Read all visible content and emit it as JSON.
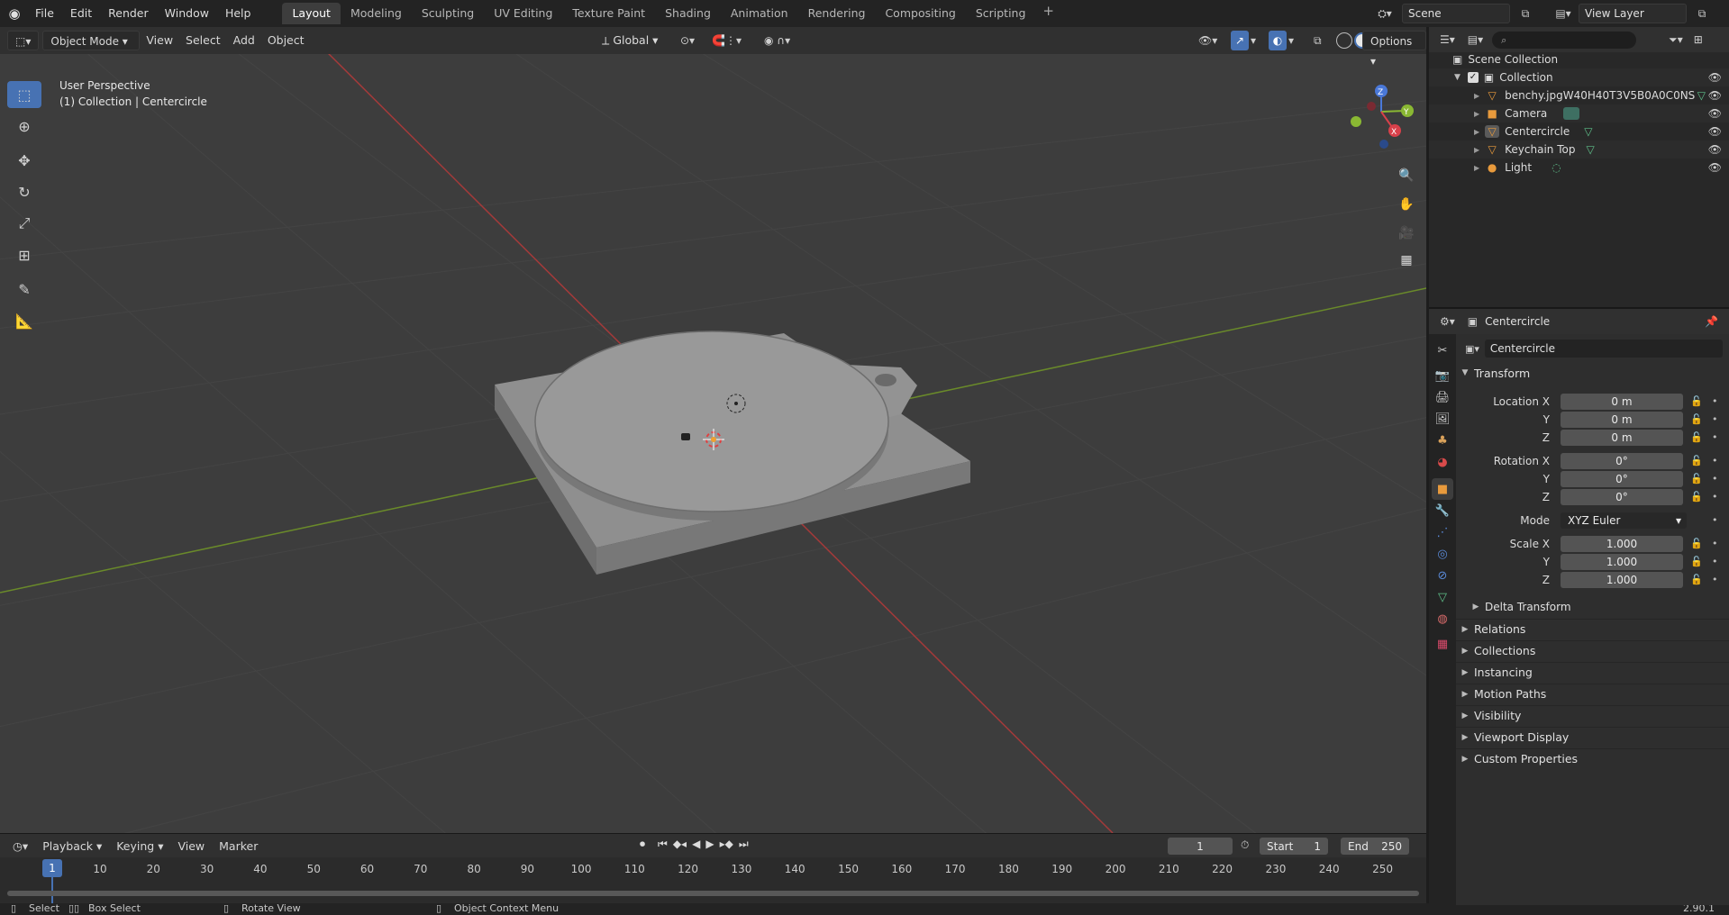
{
  "top_menu": [
    "File",
    "Edit",
    "Render",
    "Window",
    "Help"
  ],
  "workspaces": [
    "Layout",
    "Modeling",
    "Sculpting",
    "UV Editing",
    "Texture Paint",
    "Shading",
    "Animation",
    "Rendering",
    "Compositing",
    "Scripting"
  ],
  "active_workspace": "Layout",
  "scene": "Scene",
  "view_layer": "View Layer",
  "viewport": {
    "mode": "Object Mode",
    "menus": [
      "View",
      "Select",
      "Add",
      "Object"
    ],
    "transform_orientation": "Global",
    "options_label": "Options",
    "view_name": "User Perspective",
    "collection_info": "(1) Collection | Centercircle",
    "gizmo": {
      "x": "X",
      "y": "Y",
      "z": "Z"
    }
  },
  "outliner": {
    "root": "Scene Collection",
    "collection": "Collection",
    "items": [
      "benchy.jpgW40H40T3V5B0A0C0NS",
      "Camera",
      "Centercircle",
      "Keychain Top",
      "Light"
    ]
  },
  "properties": {
    "object_name": "Centercircle",
    "data_name": "Centercircle",
    "transform_label": "Transform",
    "location": {
      "label_x": "Location X",
      "x": "0 m",
      "y": "0 m",
      "z": "0 m"
    },
    "rotation": {
      "label_x": "Rotation X",
      "x": "0°",
      "y": "0°",
      "z": "0°"
    },
    "mode_label": "Mode",
    "mode_value": "XYZ Euler",
    "scale": {
      "label_x": "Scale X",
      "x": "1.000",
      "y": "1.000",
      "z": "1.000"
    },
    "axis_y": "Y",
    "axis_z": "Z",
    "delta_transform": "Delta Transform",
    "sections": [
      "Relations",
      "Collections",
      "Instancing",
      "Motion Paths",
      "Visibility",
      "Viewport Display",
      "Custom Properties"
    ]
  },
  "timeline": {
    "menus": [
      "Playback",
      "Keying",
      "View",
      "Marker"
    ],
    "current_frame": "1",
    "start_label": "Start",
    "start": "1",
    "end_label": "End",
    "end": "250",
    "ticks": [
      "10",
      "20",
      "30",
      "40",
      "50",
      "60",
      "70",
      "80",
      "90",
      "100",
      "110",
      "120",
      "130",
      "140",
      "150",
      "160",
      "170",
      "180",
      "190",
      "200",
      "210",
      "220",
      "230",
      "240",
      "250"
    ]
  },
  "statusbar": {
    "select": "Select",
    "box_select": "Box Select",
    "rotate_view": "Rotate View",
    "context_menu": "Object Context Menu",
    "version": "2.90.1"
  }
}
